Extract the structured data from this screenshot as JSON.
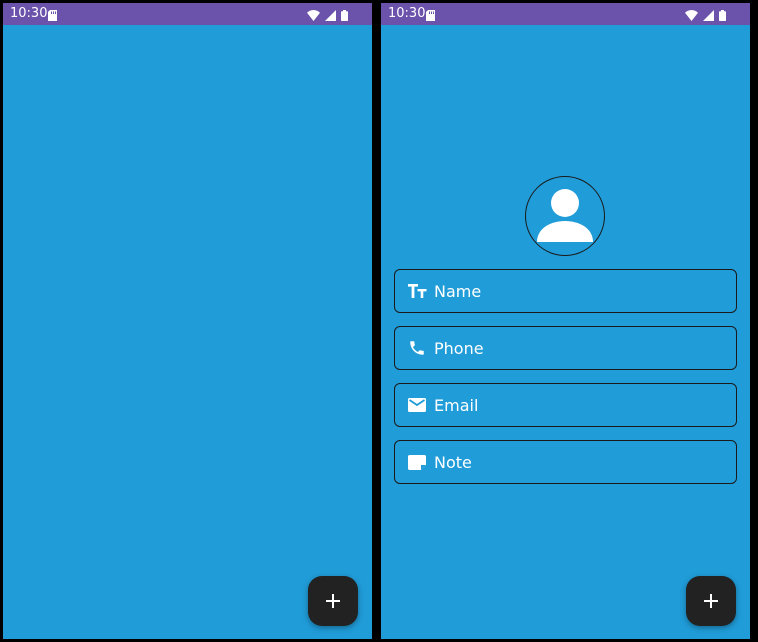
{
  "status_bar": {
    "time": "10:30"
  },
  "left_screen": {
    "fab_icon": "plus-icon"
  },
  "right_screen": {
    "avatar_icon": "person-icon",
    "fields": [
      {
        "icon": "text-size-icon",
        "label": "Name"
      },
      {
        "icon": "phone-icon",
        "label": "Phone"
      },
      {
        "icon": "email-icon",
        "label": "Email"
      },
      {
        "icon": "note-icon",
        "label": "Note"
      }
    ],
    "fab_icon": "plus-icon"
  },
  "colors": {
    "background": "#209CD8",
    "status_bar": "#6B52AA",
    "fab": "#222222",
    "text": "#FFFFFF"
  }
}
